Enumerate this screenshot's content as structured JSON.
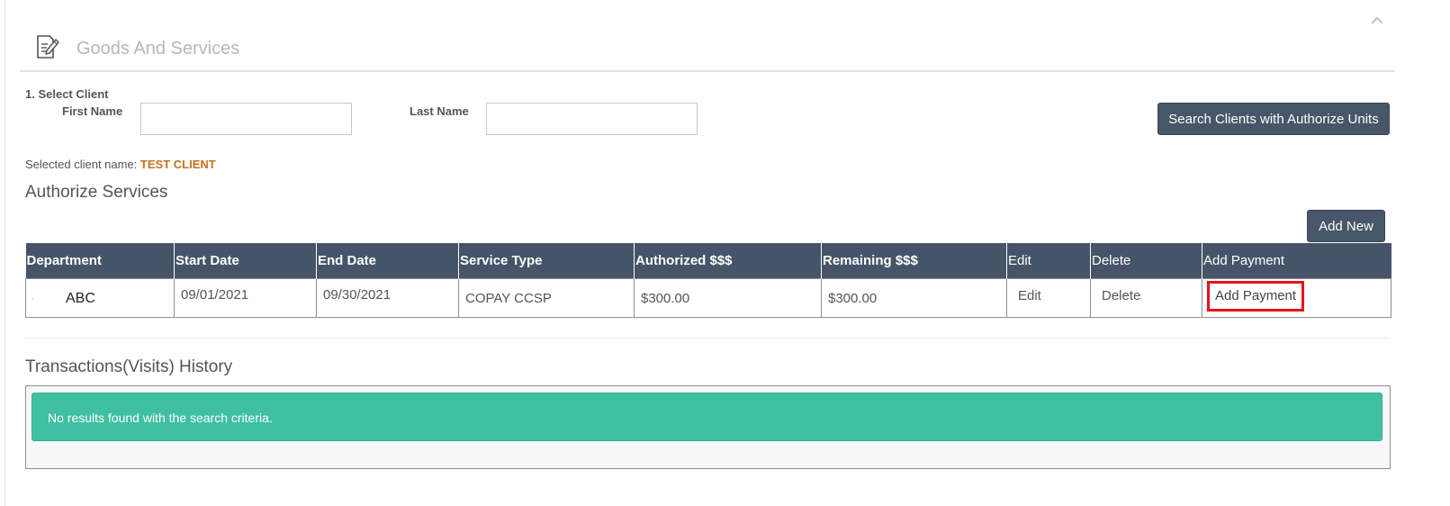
{
  "panel": {
    "title": "Goods And Services",
    "icon": "document-edit-icon",
    "collapse_icon": "chevron-up-icon"
  },
  "client_search": {
    "step_label": "1. Select Client",
    "first_name_label": "First Name",
    "first_name_value": "",
    "last_name_label": "Last Name",
    "last_name_value": "",
    "search_button_label": "Search Clients with Authorize Units"
  },
  "selected_client": {
    "label": "Selected client name:",
    "value": "TEST CLIENT"
  },
  "authorize_services": {
    "title": "Authorize Services",
    "add_new_label": "Add New",
    "columns": [
      "Department",
      "Start Date",
      "End Date",
      "Service Type",
      "Authorized $$$",
      "Remaining $$$",
      "Edit",
      "Delete",
      "Add Payment"
    ],
    "rows": [
      {
        "department": "ABC",
        "start_date": "09/01/2021",
        "end_date": "09/30/2021",
        "service_type": "COPAY CCSP",
        "authorized": "$300.00",
        "remaining": "$300.00",
        "edit_label": "Edit",
        "delete_label": "Delete",
        "add_payment_label": "Add Payment"
      }
    ]
  },
  "transactions": {
    "title": "Transactions(Visits) History",
    "empty_message": "No results found with the search criteria."
  },
  "colors": {
    "header_bg": "#455468",
    "button_bg": "#475669",
    "alert_bg": "#40c0a1",
    "selected_client_color": "#c8711c",
    "highlight_border": "#e8101c"
  }
}
